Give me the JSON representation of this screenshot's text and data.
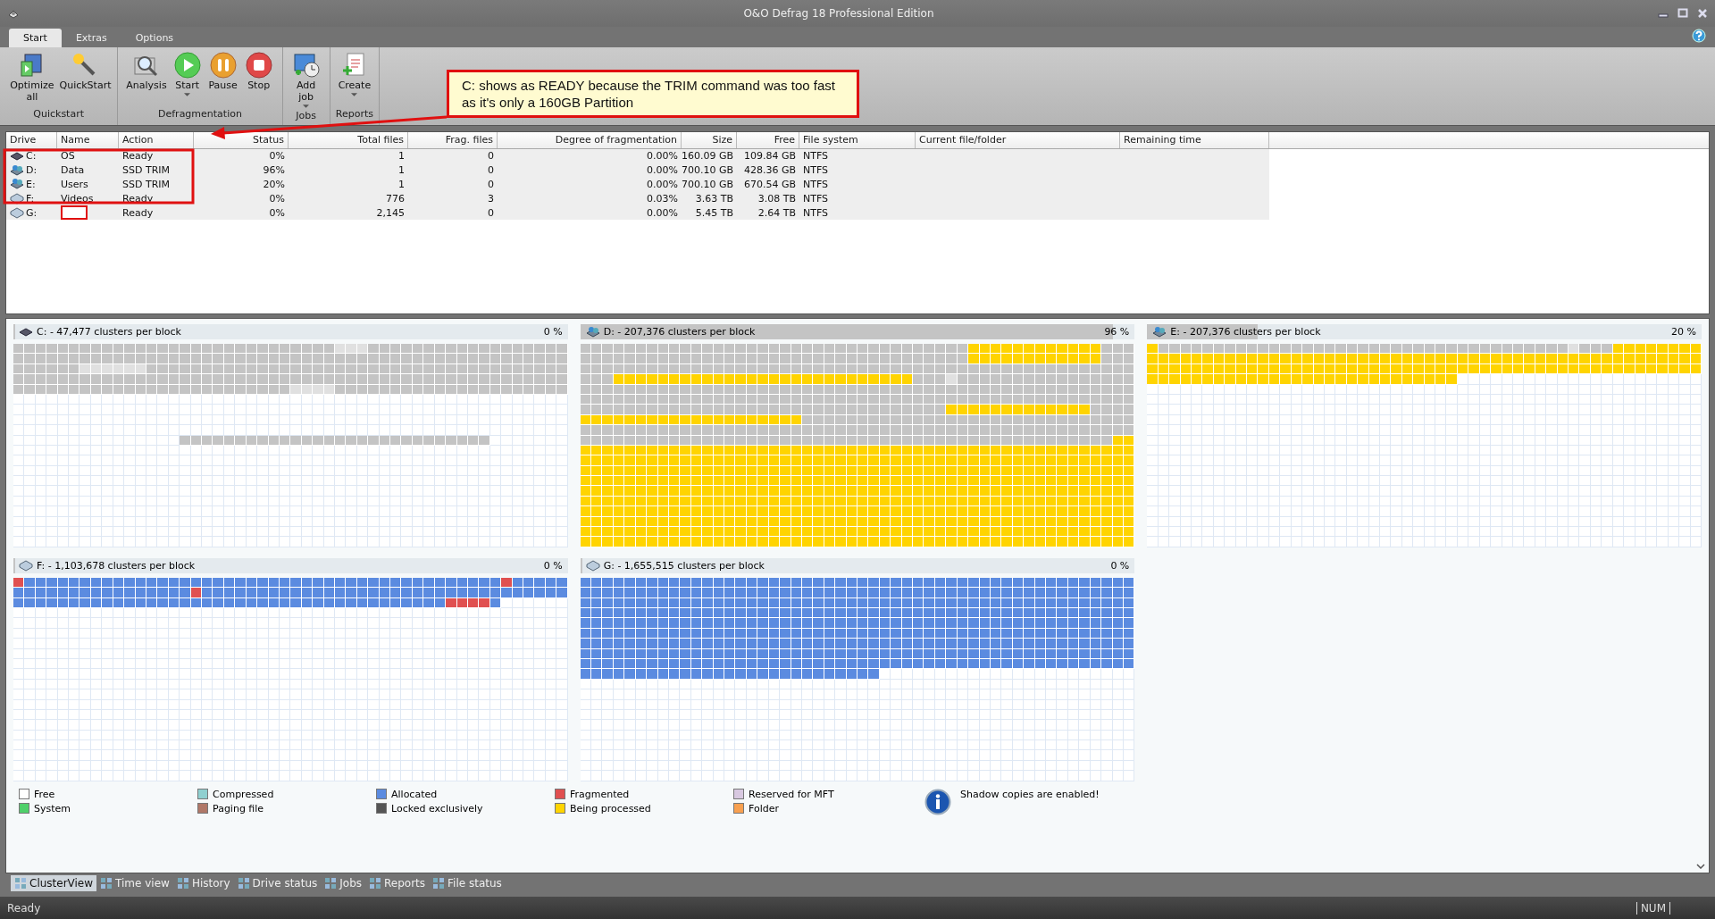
{
  "window": {
    "title": "O&O Defrag 18 Professional Edition"
  },
  "tabs": [
    {
      "label": "Start",
      "selected": true
    },
    {
      "label": "Extras",
      "selected": false
    },
    {
      "label": "Options",
      "selected": false
    }
  ],
  "ribbon_groups": [
    {
      "label": "Quickstart",
      "buttons": [
        {
          "label": "Optimize all",
          "kind": "optimize",
          "dropdown": false
        },
        {
          "label": "QuickStart",
          "kind": "wand",
          "dropdown": false
        }
      ]
    },
    {
      "label": "Defragmentation",
      "buttons": [
        {
          "label": "Analysis",
          "kind": "analysis",
          "dropdown": false
        },
        {
          "label": "Start",
          "kind": "start",
          "dropdown": true
        },
        {
          "label": "Pause",
          "kind": "pause",
          "dropdown": false
        },
        {
          "label": "Stop",
          "kind": "stop",
          "dropdown": false
        }
      ]
    },
    {
      "label": "Jobs",
      "buttons": [
        {
          "label": "Add job",
          "kind": "job",
          "dropdown": true
        }
      ]
    },
    {
      "label": "Reports",
      "buttons": [
        {
          "label": "Create",
          "kind": "report",
          "dropdown": true
        }
      ]
    }
  ],
  "annotation": {
    "text": "C: shows as READY because the TRIM command was too fast as it's only a 160GB Partition"
  },
  "table": {
    "columns": [
      "Drive",
      "Name",
      "Action",
      "Status",
      "Total files",
      "Frag. files",
      "Degree of fragmentation",
      "Size",
      "Free",
      "File system",
      "Current file/folder",
      "Remaining time"
    ],
    "rows": [
      {
        "drive": "C:",
        "name": "OS",
        "action": "Ready",
        "status": "0%",
        "total_files": "1",
        "frag_files": "0",
        "degree": "0.00%",
        "size": "160.09 GB",
        "free": "109.84 GB",
        "file_system": "NTFS",
        "kind": "ssd"
      },
      {
        "drive": "D:",
        "name": "Data",
        "action": "SSD TRIM",
        "status": "96%",
        "total_files": "1",
        "frag_files": "0",
        "degree": "0.00%",
        "size": "700.10 GB",
        "free": "428.36 GB",
        "file_system": "NTFS",
        "kind": "busy"
      },
      {
        "drive": "E:",
        "name": "Users",
        "action": "SSD TRIM",
        "status": "20%",
        "total_files": "1",
        "frag_files": "0",
        "degree": "0.00%",
        "size": "700.10 GB",
        "free": "670.54 GB",
        "file_system": "NTFS",
        "kind": "busy"
      },
      {
        "drive": "F:",
        "name": "Videos",
        "action": "Ready",
        "status": "0%",
        "total_files": "776",
        "frag_files": "3",
        "degree": "0.03%",
        "size": "3.63 TB",
        "free": "3.08 TB",
        "file_system": "NTFS",
        "kind": "hdd"
      },
      {
        "drive": "G:",
        "action": "Ready",
        "status": "0%",
        "total_files": "2,145",
        "frag_files": "0",
        "degree": "0.00%",
        "size": "5.45 TB",
        "free": "2.64 TB",
        "file_system": "NTFS",
        "kind": "hdd",
        "name_redacted": true
      }
    ]
  },
  "cluster_panels": [
    {
      "title": "C: - 47,477 clusters per block",
      "percent": "0 %",
      "level": 0,
      "kind": "ssd"
    },
    {
      "title": "D: - 207,376 clusters per block",
      "percent": "96 %",
      "level": 0.96,
      "kind": "busy"
    },
    {
      "title": "E: - 207,376 clusters per block",
      "percent": "20 %",
      "level": 0.2,
      "kind": "busy"
    },
    {
      "title": "F: - 1,103,678 clusters per block",
      "percent": "0 %",
      "level": 0,
      "kind": "hdd"
    },
    {
      "title": "G: - 1,655,515 clusters per block",
      "percent": "0 %",
      "level": 0,
      "kind": "hdd"
    }
  ],
  "legend": [
    {
      "label": "Free",
      "color": "#ffffff"
    },
    {
      "label": "System",
      "color": "#4fd06a"
    },
    {
      "label": "Compressed",
      "color": "#8fd0d0"
    },
    {
      "label": "Paging file",
      "color": "#b07868"
    },
    {
      "label": "Allocated",
      "color": "#5b8be0"
    },
    {
      "label": "Locked exclusively",
      "color": "#555555"
    },
    {
      "label": "Fragmented",
      "color": "#e05050"
    },
    {
      "label": "Being processed",
      "color": "#ffd400"
    },
    {
      "label": "Reserved for MFT",
      "color": "#d8c8e0"
    },
    {
      "label": "Folder",
      "color": "#f8a050"
    }
  ],
  "notice": "Shadow copies are enabled!",
  "view_tabs": [
    {
      "label": "ClusterView",
      "selected": true
    },
    {
      "label": "Time view",
      "selected": false
    },
    {
      "label": "History",
      "selected": false
    },
    {
      "label": "Drive status",
      "selected": false
    },
    {
      "label": "Jobs",
      "selected": false
    },
    {
      "label": "Reports",
      "selected": false
    },
    {
      "label": "File status",
      "selected": false
    }
  ],
  "status_bar": {
    "text": "Ready",
    "indicator": "NUM"
  }
}
